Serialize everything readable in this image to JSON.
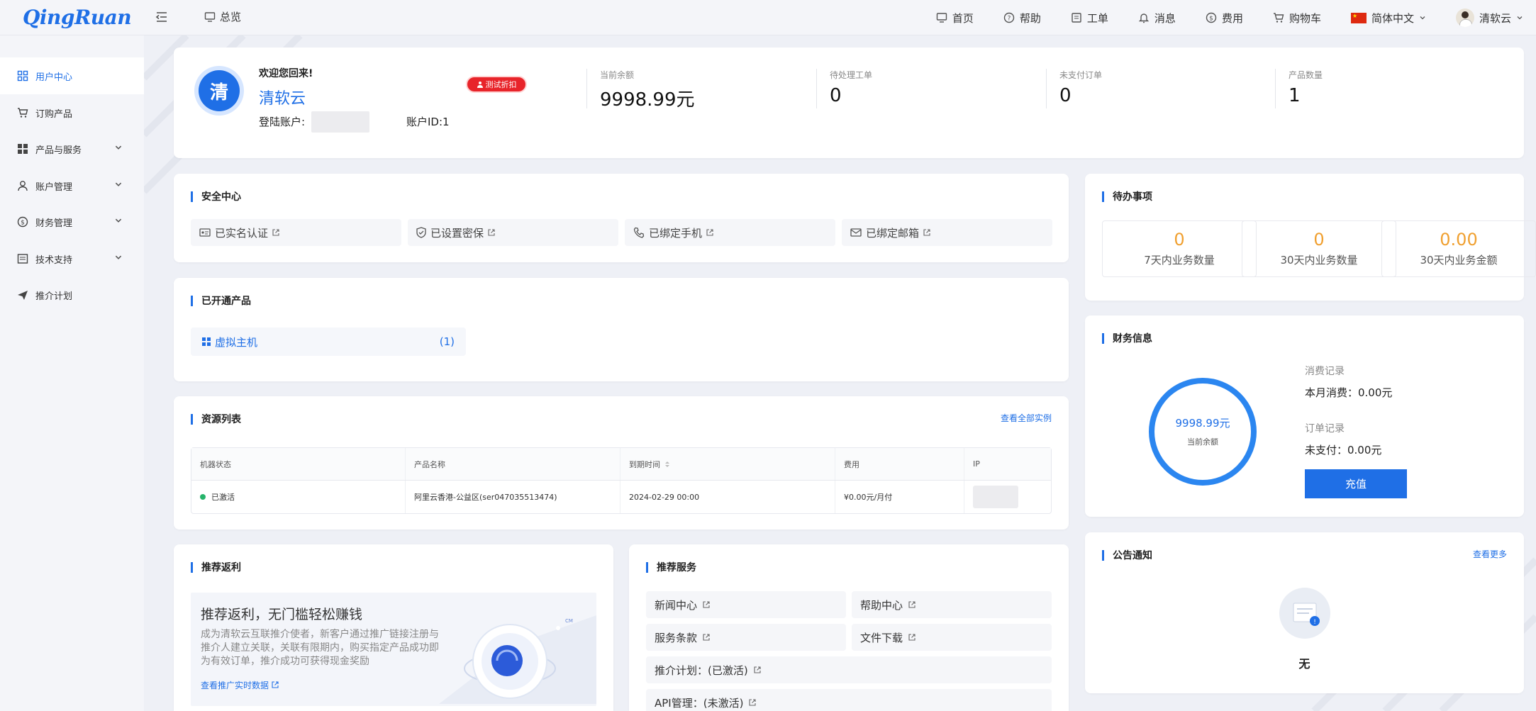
{
  "header": {
    "logo": "QingRuan",
    "overview_label": "总览",
    "nav": [
      {
        "label": "首页",
        "icon": "monitor-icon"
      },
      {
        "label": "帮助",
        "icon": "help-circle-icon"
      },
      {
        "label": "工单",
        "icon": "ticket-icon"
      },
      {
        "label": "消息",
        "icon": "bell-icon"
      },
      {
        "label": "费用",
        "icon": "dollar-icon"
      },
      {
        "label": "购物车",
        "icon": "cart-icon"
      }
    ],
    "language": "简体中文",
    "username": "清软云"
  },
  "sidebar": {
    "items": [
      {
        "label": "用户中心",
        "icon": "grid-icon"
      },
      {
        "label": "订购产品",
        "icon": "cart-icon"
      },
      {
        "label": "产品与服务",
        "icon": "apps-icon"
      },
      {
        "label": "账户管理",
        "icon": "user-icon"
      },
      {
        "label": "财务管理",
        "icon": "dollar-icon"
      },
      {
        "label": "技术支持",
        "icon": "document-icon"
      },
      {
        "label": "推介计划",
        "icon": "send-icon"
      }
    ]
  },
  "welcome": {
    "avatar_char": "清",
    "greeting": "欢迎您回来!",
    "name": "清软云",
    "badge": "测试折扣",
    "account_label": "登陆账户:",
    "account_id": "账户ID:1",
    "stats": [
      {
        "label": "当前余额",
        "value": "9998.99元"
      },
      {
        "label": "待处理工单",
        "value": "0"
      },
      {
        "label": "未支付订单",
        "value": "0"
      },
      {
        "label": "产品数量",
        "value": "1"
      }
    ]
  },
  "security": {
    "title": "安全中心",
    "items": [
      "已实名认证",
      "已设置密保",
      "已绑定手机",
      "已绑定邮箱"
    ]
  },
  "products": {
    "title": "已开通产品",
    "items": [
      {
        "name": "虚拟主机",
        "count": "(1)"
      }
    ]
  },
  "resources": {
    "title": "资源列表",
    "link": "查看全部实例",
    "columns": [
      "机器状态",
      "产品名称",
      "到期时间",
      "费用",
      "IP"
    ],
    "rows": [
      {
        "status": "已激活",
        "name": "阿里云香港-公益区(ser047035513474)",
        "expires": "2024-02-29 00:00",
        "fee": "¥0.00元/月付"
      }
    ]
  },
  "referral": {
    "title": "推荐返利",
    "headline": "推荐返利，无门槛轻松赚钱",
    "description": "成为清软云互联推介使者，新客户通过推广链接注册与推介人建立关联，关联有限期内，购买指定产品成功即为有效订单，推介成功可获得现金奖励",
    "link": "查看推广实时数据"
  },
  "services": {
    "title": "推荐服务",
    "items": [
      "新闻中心",
      "帮助中心",
      "服务条款",
      "文件下载",
      "推介计划：(已激活)",
      "API管理：(未激活)"
    ]
  },
  "todo": {
    "title": "待办事项",
    "items": [
      {
        "value": "0",
        "label": "7天内业务数量"
      },
      {
        "value": "0",
        "label": "30天内业务数量"
      },
      {
        "value": "0.00",
        "label": "30天内业务金额"
      }
    ]
  },
  "finance": {
    "title": "财务信息",
    "balance": "9998.99元",
    "balance_label": "当前余额",
    "consume_label": "消费记录",
    "consume_value": "本月消费：0.00元",
    "order_label": "订单记录",
    "order_value": "未支付：0.00元",
    "recharge": "充值"
  },
  "notice": {
    "title": "公告通知",
    "link": "查看更多",
    "empty": "无"
  },
  "colors": {
    "accent": "#1f6fe6",
    "warning": "#f0a030",
    "success": "#26b36a",
    "danger": "#e8242a"
  }
}
